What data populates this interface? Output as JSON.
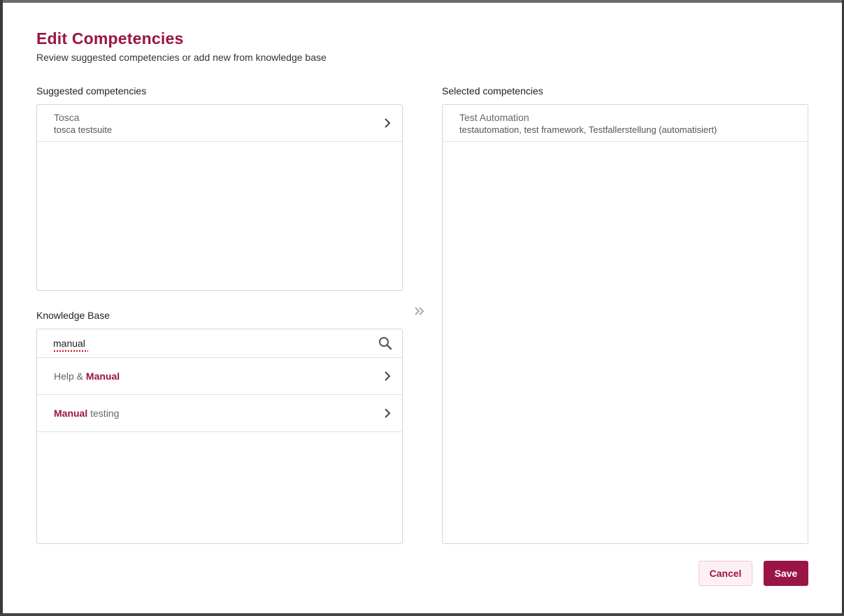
{
  "dialog": {
    "title": "Edit Competencies",
    "subtitle": "Review suggested competencies or add new from knowledge base"
  },
  "suggested": {
    "label": "Suggested competencies",
    "items": [
      {
        "name": "Tosca",
        "keywords": "tosca testsuite"
      }
    ]
  },
  "selected": {
    "label": "Selected competencies",
    "items": [
      {
        "name": "Test Automation",
        "keywords": "testautomation, test framework, Testfallerstellung (automatisiert)"
      }
    ]
  },
  "knowledge_base": {
    "label": "Knowledge Base",
    "search_value": "manual",
    "results": [
      {
        "prefix": "Help & ",
        "match": "Manual",
        "suffix": ""
      },
      {
        "prefix": "",
        "match": "Manual",
        "suffix": " testing"
      }
    ]
  },
  "buttons": {
    "cancel": "Cancel",
    "save": "Save"
  },
  "colors": {
    "accent": "#9b1446",
    "cancel_bg": "#fdf0f3"
  },
  "icons": {
    "search": "search-icon",
    "chevron": "chevron-right-icon",
    "transfer": "double-chevron-right-icon"
  }
}
